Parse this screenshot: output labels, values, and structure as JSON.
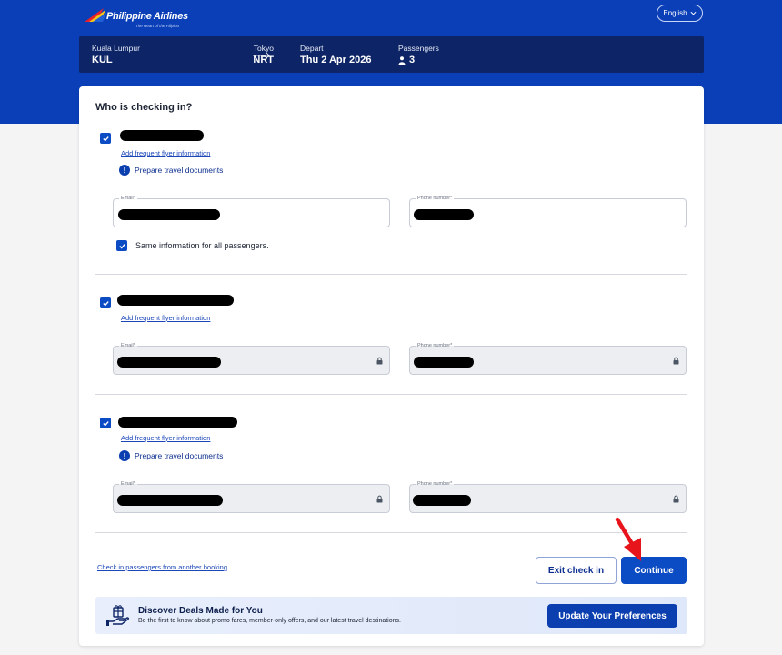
{
  "brand": {
    "name": "Philippine Airlines",
    "tagline": "The Heart of the Filipino"
  },
  "header": {
    "language": "English"
  },
  "flight": {
    "origin_city": "Kuala Lumpur",
    "origin_code": "KUL",
    "destination_city": "Tokyo",
    "destination_code": "NRT",
    "depart_label": "Depart",
    "depart_date": "Thu 2 Apr 2026",
    "passengers_label": "Passengers",
    "passengers_count": "3"
  },
  "checkin": {
    "title": "Who is checking in?",
    "ff_link": "Add frequent flyer information",
    "prep_docs": "Prepare travel documents",
    "email_label": "Email*",
    "phone_label": "Phone number*",
    "same_info_label": "Same information for all passengers.",
    "passengers": [
      {
        "checked": true,
        "fields_locked": false,
        "has_prep_docs": true
      },
      {
        "checked": true,
        "fields_locked": true,
        "has_prep_docs": false
      },
      {
        "checked": true,
        "fields_locked": true,
        "has_prep_docs": true
      }
    ]
  },
  "footer": {
    "other_booking_link": "Check in passengers from another booking",
    "exit_label": "Exit check in",
    "continue_label": "Continue"
  },
  "promo": {
    "title": "Discover Deals Made for You",
    "subtitle": "Be the first to know about promo fares, member-only offers, and our latest travel destinations.",
    "button_label": "Update Your Preferences"
  },
  "colors": {
    "primary": "#0b4bc4",
    "header_band": "#0a3fb8",
    "flight_bar": "#0d2466",
    "annotation_arrow": "#e8141b"
  }
}
